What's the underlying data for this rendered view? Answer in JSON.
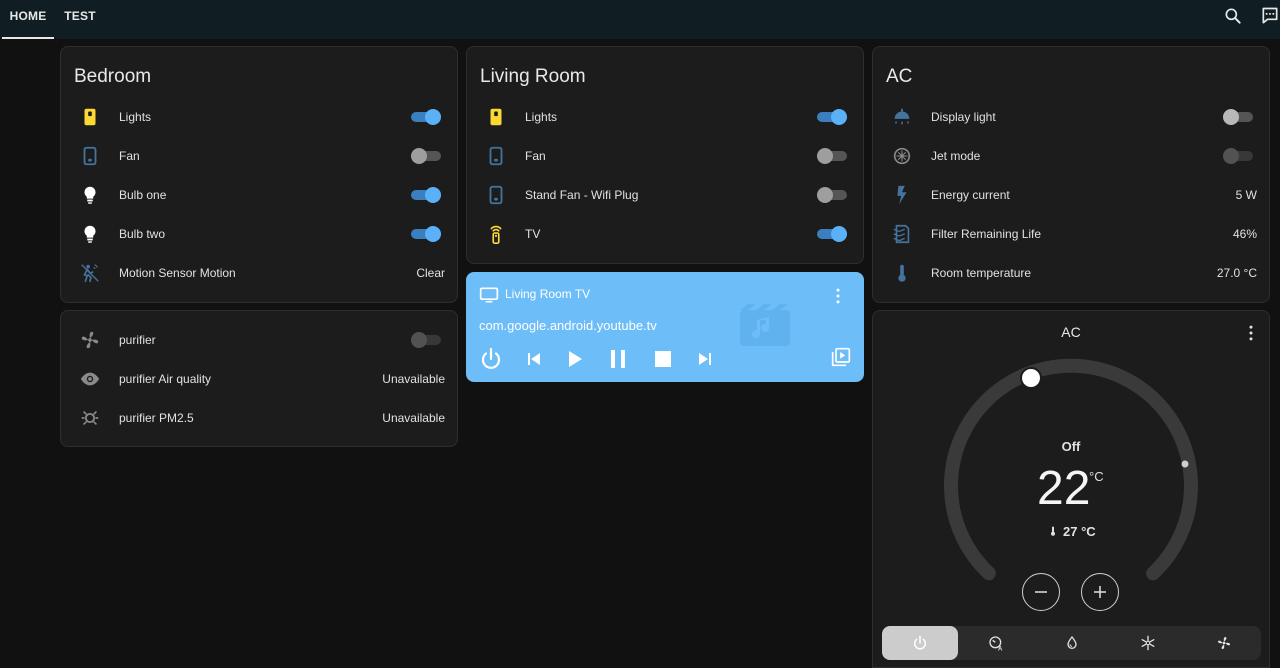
{
  "tabs": [
    {
      "label": "HOME"
    },
    {
      "label": "TEST"
    }
  ],
  "header_icons": [
    "search-icon",
    "assist-chat-icon"
  ],
  "bedroom": {
    "title": "Bedroom",
    "rows": [
      {
        "name": "Lights",
        "icon": "light-switch-icon",
        "state": "on"
      },
      {
        "name": "Fan",
        "icon": "phone-switch-icon",
        "state": "off"
      },
      {
        "name": "Bulb one",
        "icon": "bulb-icon",
        "state": "on"
      },
      {
        "name": "Bulb two",
        "icon": "bulb-icon",
        "state": "on"
      },
      {
        "name": "Motion Sensor Motion",
        "icon": "motion-sensor-icon",
        "value": "Clear"
      }
    ]
  },
  "purifier": {
    "rows": [
      {
        "name": "purifier",
        "icon": "fan-icon",
        "state": "off"
      },
      {
        "name": "purifier Air quality",
        "icon": "eye-icon",
        "value": "Unavailable"
      },
      {
        "name": "purifier PM2.5",
        "icon": "pm-sensor-icon",
        "value": "Unavailable"
      }
    ]
  },
  "living_room": {
    "title": "Living Room",
    "rows": [
      {
        "name": "Lights",
        "icon": "light-switch-icon",
        "state": "on"
      },
      {
        "name": "Fan",
        "icon": "phone-switch-icon",
        "state": "off"
      },
      {
        "name": "Stand Fan - Wifi Plug",
        "icon": "phone-switch-icon",
        "state": "off"
      },
      {
        "name": "TV",
        "icon": "remote-icon",
        "state": "on"
      }
    ]
  },
  "media_player": {
    "title": "Living Room TV",
    "app": "com.google.android.youtube.tv",
    "controls": [
      "power-icon",
      "previous-icon",
      "play-icon",
      "pause-icon",
      "stop-icon",
      "next-icon",
      "source-icon"
    ]
  },
  "ac": {
    "title": "AC",
    "rows": [
      {
        "name": "Display light",
        "icon": "ceiling-light-icon",
        "state": "off"
      },
      {
        "name": "Jet mode",
        "icon": "jet-icon",
        "state": "off"
      },
      {
        "name": "Energy current",
        "icon": "lightning-icon",
        "value": "5 W"
      },
      {
        "name": "Filter Remaining Life",
        "icon": "filter-icon",
        "value": "46%"
      },
      {
        "name": "Room temperature",
        "icon": "thermometer-icon",
        "value": "27.0 °C"
      }
    ]
  },
  "thermostat": {
    "title": "AC",
    "mode_label": "Off",
    "target": "22",
    "unit": "°C",
    "current": "27 °C",
    "modes": [
      {
        "icon": "power-icon",
        "active": true
      },
      {
        "icon": "auto-icon",
        "active": false
      },
      {
        "icon": "dry-icon",
        "active": false
      },
      {
        "icon": "cool-icon",
        "active": false
      },
      {
        "icon": "fan-only-icon",
        "active": false
      }
    ]
  },
  "colors": {
    "accent": "#5ab1f7",
    "icon_yellow": "#fdd835",
    "icon_blue": "#44739e",
    "media_bg": "#6dbdf8"
  }
}
